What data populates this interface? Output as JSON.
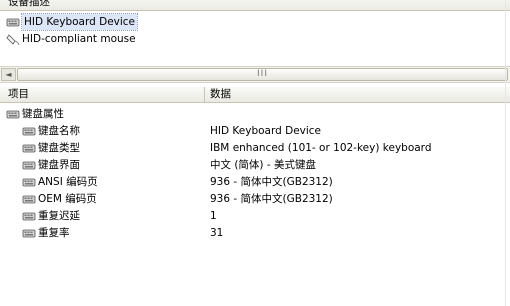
{
  "device_list": {
    "header": "设备描述",
    "items": [
      {
        "label": "HID Keyboard Device",
        "icon": "keyboard-icon",
        "selected": true
      },
      {
        "label": "HID-compliant mouse",
        "icon": "mouse-icon",
        "selected": false
      }
    ],
    "scroll_left_glyph": "◄",
    "scroll_grip_glyph": "III"
  },
  "properties": {
    "col_item": "项目",
    "col_data": "数据",
    "group": {
      "label": "键盘属性",
      "icon": "keyboard-icon"
    },
    "rows": [
      {
        "label": "键盘名称",
        "value": "HID Keyboard Device"
      },
      {
        "label": "键盘类型",
        "value": "IBM enhanced (101- or 102-key) keyboard"
      },
      {
        "label": "键盘界面",
        "value": "中文 (简体) - 美式键盘"
      },
      {
        "label": "ANSI 编码页",
        "value": "936 - 简体中文(GB2312)"
      },
      {
        "label": "OEM 编码页",
        "value": "936 - 简体中文(GB2312)"
      },
      {
        "label": "重复迟延",
        "value": "1"
      },
      {
        "label": "重复率",
        "value": "31"
      }
    ]
  }
}
